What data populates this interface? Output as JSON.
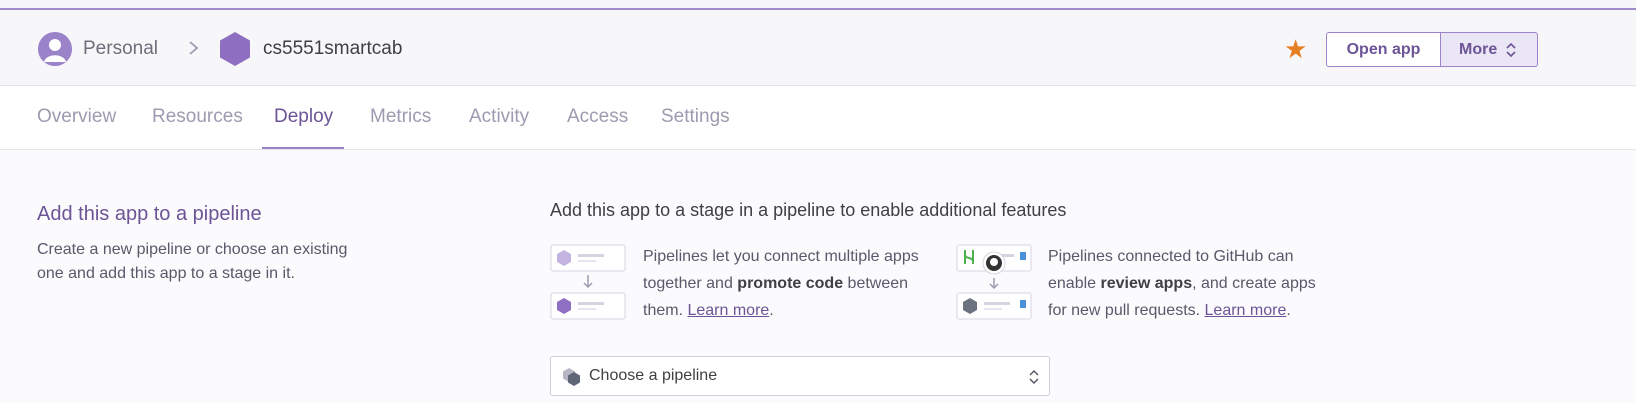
{
  "header": {
    "breadcrumb_personal": "Personal",
    "app_name": "cs5551smartcab",
    "open_app_label": "Open app",
    "more_label": "More",
    "accent_color": "#9b83c9",
    "star_color": "#e67e22"
  },
  "tabs": [
    {
      "label": "Overview"
    },
    {
      "label": "Resources"
    },
    {
      "label": "Deploy",
      "active": true
    },
    {
      "label": "Metrics"
    },
    {
      "label": "Activity"
    },
    {
      "label": "Access"
    },
    {
      "label": "Settings"
    }
  ],
  "pipeline": {
    "title": "Add this app to a pipeline",
    "description": "Create a new pipeline or choose an existing one and add this app to a stage in it.",
    "subtitle": "Add this app to a stage in a pipeline to enable additional features",
    "feature1": {
      "text_a": "Pipelines let you connect multiple apps together and ",
      "bold": "promote code",
      "text_b": " between them. ",
      "link": "Learn more",
      "end": "."
    },
    "feature2": {
      "text_a": "Pipelines connected to GitHub can enable ",
      "bold": "review apps",
      "text_b": ", and create apps for new pull requests. ",
      "link": "Learn more",
      "end": "."
    },
    "select_label": "Choose a pipeline"
  }
}
